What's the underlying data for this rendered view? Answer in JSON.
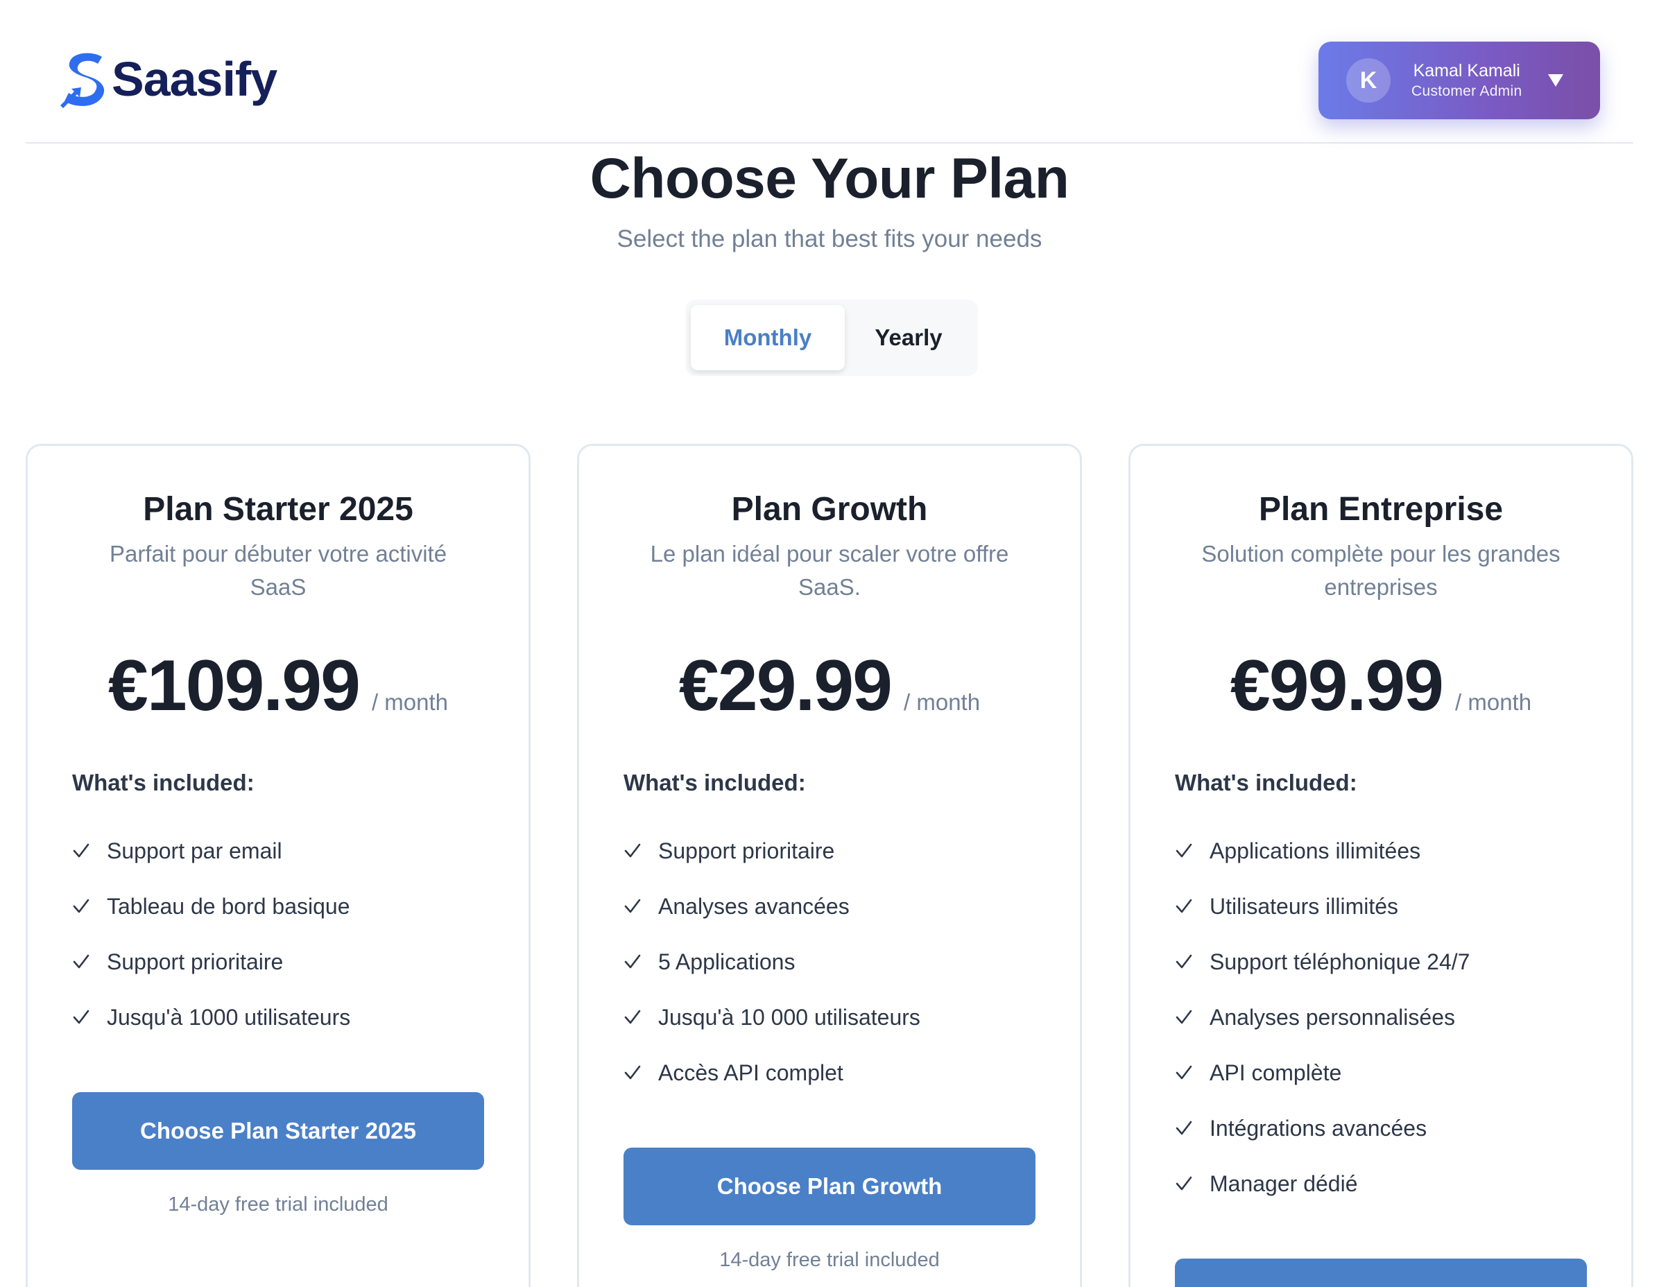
{
  "brand": {
    "name": "Saasify",
    "logo_icon": "s-arrow-logo-icon",
    "colors": {
      "primary": "#4a80c8",
      "brand_text": "#15205a",
      "logo_blue": "#2f6df0"
    }
  },
  "user": {
    "initial": "K",
    "name": "Kamal Kamali",
    "role": "Customer Admin",
    "menu_icon": "caret-down-icon"
  },
  "hero": {
    "title": "Choose Your Plan",
    "subtitle": "Select the plan that best fits your needs"
  },
  "billing_toggle": {
    "options": [
      "Monthly",
      "Yearly"
    ],
    "selected": "Monthly"
  },
  "included_heading": "What's included:",
  "plans": [
    {
      "name": "Plan Starter 2025",
      "description": "Parfait pour débuter votre activité SaaS",
      "price": "€109.99",
      "period": "/ month",
      "features": [
        "Support par email",
        "Tableau de bord basique",
        "Support prioritaire",
        "Jusqu'à 1000 utilisateurs"
      ],
      "cta": "Choose Plan Starter 2025",
      "trial": "14-day free trial included"
    },
    {
      "name": "Plan Growth",
      "description": "Le plan idéal pour scaler votre offre SaaS.",
      "price": "€29.99",
      "period": "/ month",
      "features": [
        "Support prioritaire",
        "Analyses avancées",
        "5 Applications",
        "Jusqu'à 10 000 utilisateurs",
        "Accès API complet"
      ],
      "cta": "Choose Plan Growth",
      "trial": "14-day free trial included"
    },
    {
      "name": "Plan Entreprise",
      "description": "Solution complète pour les grandes entreprises",
      "price": "€99.99",
      "period": "/ month",
      "features": [
        "Applications illimitées",
        "Utilisateurs illimités",
        "Support téléphonique 24/7",
        "Analyses personnalisées",
        "API complète",
        "Intégrations avancées",
        "Manager dédié"
      ],
      "cta": "",
      "trial": ""
    }
  ]
}
